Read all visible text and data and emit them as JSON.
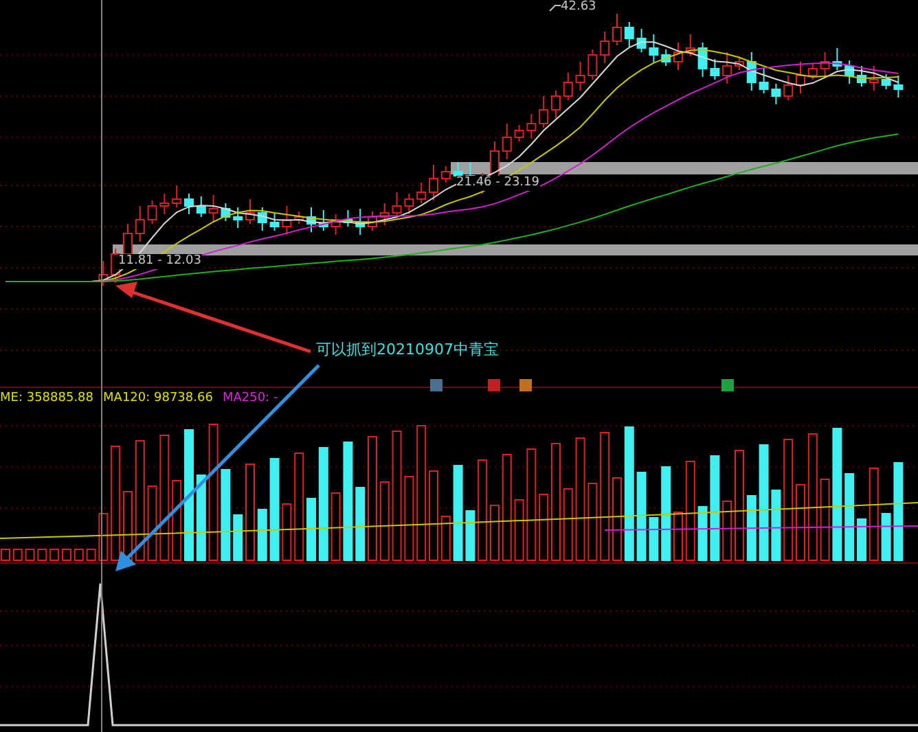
{
  "price_panel": {
    "high_label": "42.63",
    "ranges": [
      {
        "label": "21.46 - 23.19"
      },
      {
        "label": "11.81 - 12.03"
      }
    ],
    "annotation": "可以抓到20210907中青宝"
  },
  "volume_panel": {
    "indicators": [
      {
        "text": "ME: 358885.88",
        "color": "#e0e000"
      },
      {
        "text": "MA120: 98738.66",
        "color": "#e0e000"
      },
      {
        "text": "MA250: -",
        "color": "#e020e0"
      }
    ]
  }
}
